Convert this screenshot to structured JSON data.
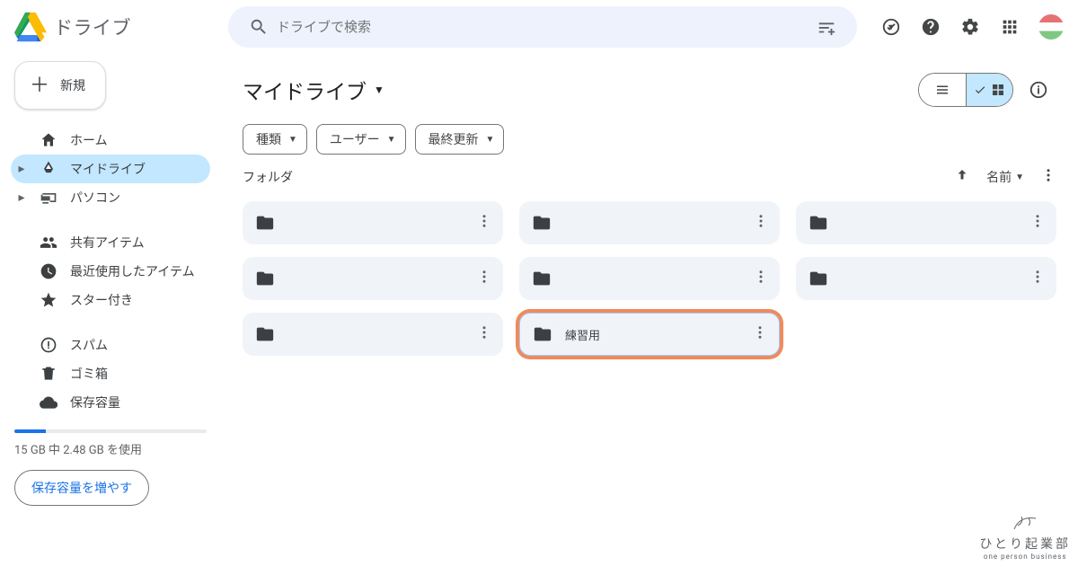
{
  "header": {
    "app_name": "ドライブ",
    "search_placeholder": "ドライブで検索"
  },
  "sidebar": {
    "new_label": "新規",
    "items": [
      {
        "label": "ホーム",
        "icon": "home",
        "expandable": false
      },
      {
        "label": "マイドライブ",
        "icon": "drive",
        "expandable": true,
        "active": true
      },
      {
        "label": "パソコン",
        "icon": "devices",
        "expandable": true
      }
    ],
    "items2": [
      {
        "label": "共有アイテム",
        "icon": "people"
      },
      {
        "label": "最近使用したアイテム",
        "icon": "clock"
      },
      {
        "label": "スター付き",
        "icon": "star"
      }
    ],
    "items3": [
      {
        "label": "スパム",
        "icon": "spam"
      },
      {
        "label": "ゴミ箱",
        "icon": "trash"
      },
      {
        "label": "保存容量",
        "icon": "cloud"
      }
    ],
    "storage_text": "15 GB 中 2.48 GB を使用",
    "storage_cta": "保存容量を増やす"
  },
  "main": {
    "title": "マイドライブ",
    "chips": [
      {
        "label": "種類"
      },
      {
        "label": "ユーザー"
      },
      {
        "label": "最終更新"
      }
    ],
    "section_label": "フォルダ",
    "sort_label": "名前",
    "folders": [
      {
        "label": ""
      },
      {
        "label": ""
      },
      {
        "label": ""
      },
      {
        "label": ""
      },
      {
        "label": ""
      },
      {
        "label": ""
      },
      {
        "label": ""
      },
      {
        "label": "練習用",
        "highlight": true
      }
    ]
  },
  "watermark": {
    "jp": "ひとり起業部",
    "en": "one person business"
  }
}
